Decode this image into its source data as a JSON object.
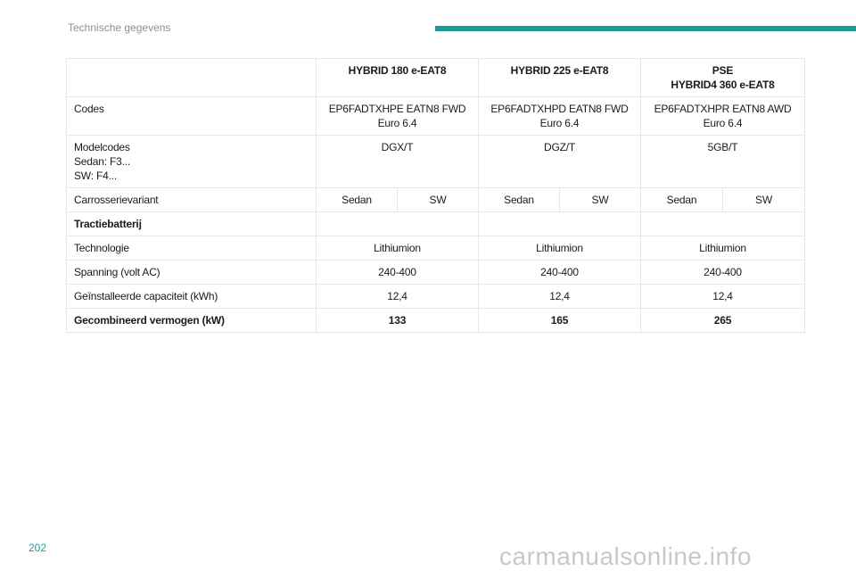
{
  "header": {
    "section_title": "Technische gegevens",
    "accent_color": "#1f9a9c"
  },
  "table": {
    "header": {
      "col1": "HYBRID 180 e-EAT8",
      "col2": "HYBRID 225 e-EAT8",
      "col3": "PSE\nHYBRID4 360 e-EAT8"
    },
    "codes": {
      "label": "Codes",
      "col1": "EP6FADTXHPE EATN8 FWD\nEuro 6.4",
      "col2": "EP6FADTXHPD EATN8 FWD\nEuro 6.4",
      "col3": "EP6FADTXHPR EATN8 AWD\nEuro 6.4"
    },
    "modelcodes": {
      "label": "Modelcodes\nSedan: F3...\nSW: F4...",
      "col1": "DGX/T",
      "col2": "DGZ/T",
      "col3": "5GB/T"
    },
    "body": {
      "label": "Carrosserievariant",
      "values": [
        "Sedan",
        "SW",
        "Sedan",
        "SW",
        "Sedan",
        "SW"
      ]
    },
    "battery_heading": "Tractiebatterij",
    "technology": {
      "label": "Technologie",
      "col1": "Lithiumion",
      "col2": "Lithiumion",
      "col3": "Lithiumion"
    },
    "voltage": {
      "label": "Spanning (volt AC)",
      "col1": "240-400",
      "col2": "240-400",
      "col3": "240-400"
    },
    "capacity": {
      "label": "Geïnstalleerde capaciteit (kWh)",
      "col1": "12,4",
      "col2": "12,4",
      "col3": "12,4"
    },
    "power": {
      "label": "Gecombineerd vermogen (kW)",
      "col1": "133",
      "col2": "165",
      "col3": "265"
    }
  },
  "footer": {
    "page_number": "202",
    "watermark": "carmanualsonline.info"
  }
}
